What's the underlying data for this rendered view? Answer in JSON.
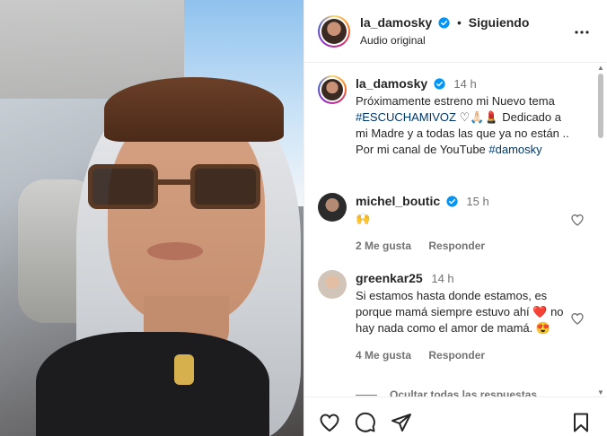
{
  "header": {
    "username": "la_damosky",
    "separator": "•",
    "follow_label": "Siguiendo",
    "audio": "Audio original"
  },
  "caption": {
    "username": "la_damosky",
    "time": "14 h",
    "text_1": "Próximamente estreno mi Nuevo tema ",
    "hashtag_1": "#ESCUCHAMIVOZ",
    "text_2": " ♡🙏🏻💄 Dedicado a mi Madre y a todas las que ya no están .. Por mi canal de YouTube ",
    "hashtag_2": "#damosky"
  },
  "comments": [
    {
      "username": "michel_boutic",
      "time": "15 h",
      "text": "🙌",
      "likes": "2 Me gusta",
      "reply": "Responder"
    },
    {
      "username": "greenkar25",
      "time": "14 h",
      "text_1": "Si estamos hasta donde estamos, es porque mamá siempre estuvo ahí ",
      "heart_emoji": "❤️",
      "text_2": " no hay nada como el amor de mamá. 😍",
      "likes": "4 Me gusta",
      "reply": "Responder"
    }
  ],
  "hide_replies": "Ocultar todas las respuestas",
  "icons": {
    "verified": "verified-badge-icon",
    "more": "more-options-icon",
    "like": "heart-icon",
    "comment": "comment-icon",
    "share": "send-icon",
    "save": "bookmark-icon"
  },
  "colors": {
    "verified": "#0095f6",
    "hashtag": "#00376b",
    "secondary_text": "#737373"
  }
}
